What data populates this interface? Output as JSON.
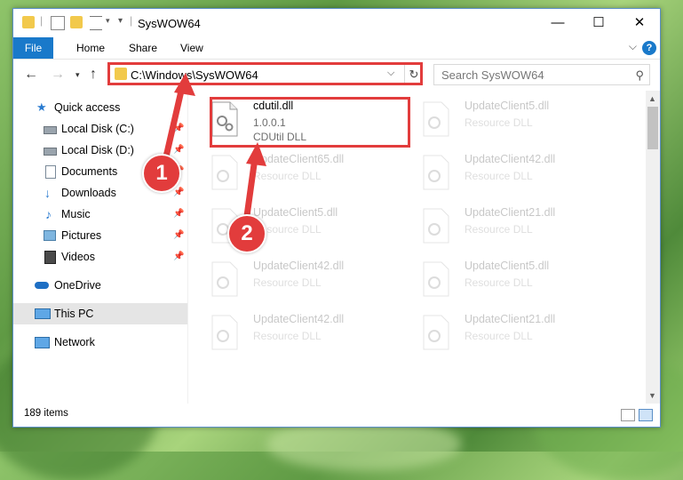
{
  "window": {
    "title": "SysWOW64",
    "controls": {
      "minimize": "—",
      "maximize": "☐",
      "close": "✕"
    }
  },
  "ribbon": {
    "tabs": [
      "File",
      "Home",
      "Share",
      "View"
    ],
    "help": "?"
  },
  "address": {
    "path": "C:\\Windows\\SysWOW64",
    "search_placeholder": "Search SysWOW64"
  },
  "sidebar": {
    "items": [
      {
        "label": "Quick access",
        "icon": "star-icon",
        "pinned": false
      },
      {
        "label": "Local Disk (C:)",
        "icon": "drive-icon",
        "pinned": true
      },
      {
        "label": "Local Disk (D:)",
        "icon": "drive-icon",
        "pinned": true
      },
      {
        "label": "Documents",
        "icon": "documents-icon",
        "pinned": true
      },
      {
        "label": "Downloads",
        "icon": "download-icon",
        "pinned": true
      },
      {
        "label": "Music",
        "icon": "music-icon",
        "pinned": true
      },
      {
        "label": "Pictures",
        "icon": "pictures-icon",
        "pinned": true
      },
      {
        "label": "Videos",
        "icon": "videos-icon",
        "pinned": true
      },
      {
        "label": "OneDrive",
        "icon": "cloud-icon",
        "pinned": false
      },
      {
        "label": "This PC",
        "icon": "computer-icon",
        "pinned": false,
        "selected": true
      },
      {
        "label": "Network",
        "icon": "network-icon",
        "pinned": false
      }
    ]
  },
  "files": [
    {
      "name": "cdutil.dll",
      "line2": "1.0.0.1",
      "line3": "CDUtil DLL",
      "highlighted": true
    },
    {
      "name": "UpdateClient5.dll",
      "line2": "Resource DLL"
    },
    {
      "name": "UpdateClient65.dll",
      "line2": "Resource DLL"
    },
    {
      "name": "UpdateClient42.dll",
      "line2": "Resource DLL"
    },
    {
      "name": "UpdateClient5.dll",
      "line2": "Resource DLL"
    },
    {
      "name": "UpdateClient21.dll",
      "line2": "Resource DLL"
    },
    {
      "name": "UpdateClient42.dll",
      "line2": "Resource DLL"
    },
    {
      "name": "UpdateClient5.dll",
      "line2": "Resource DLL"
    },
    {
      "name": "UpdateClient42.dll",
      "line2": "Resource DLL"
    },
    {
      "name": "UpdateClient21.dll",
      "line2": "Resource DLL"
    }
  ],
  "status": {
    "items_count": "189 items"
  },
  "callouts": [
    "1",
    "2"
  ],
  "colors": {
    "accent": "#1979ca",
    "callout": "#e23c3c",
    "selected": "#e5e5e5"
  }
}
